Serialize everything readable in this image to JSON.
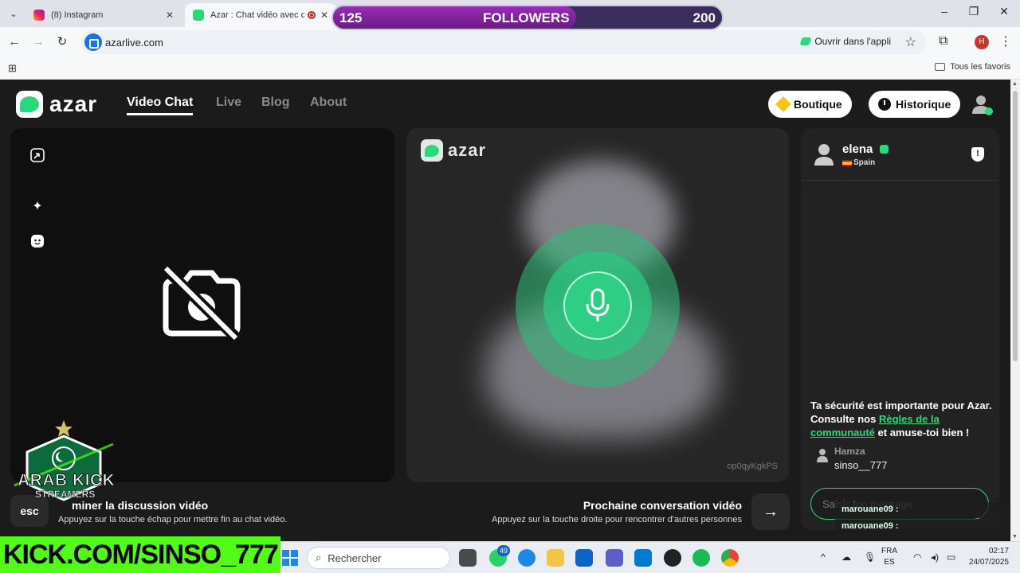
{
  "browser": {
    "tabs": [
      {
        "title": "(8) Instagram",
        "favicon": "instagram-icon"
      },
      {
        "title": "Azar : Chat vidéo avec de n",
        "favicon": "azar-icon"
      }
    ],
    "url": "azarlive.com",
    "open_in_app": "Ouvrir dans l'appli",
    "profile_initial": "H",
    "all_bookmarks": "Tous les favoris"
  },
  "overlay": {
    "followers_current": "125",
    "followers_label": "FOLLOWERS",
    "followers_goal": "200",
    "followers_progress": 0.625,
    "badge_line1": "ARAB KICK",
    "badge_line2": "STREAMERS",
    "kick_url": "KICK.COM/SINSO_777",
    "chat_lines": [
      {
        "user": "marouane09 :"
      },
      {
        "user": "marouane09 :"
      }
    ]
  },
  "nav": {
    "brand": "azar",
    "links": [
      "Video Chat",
      "Live",
      "Blog",
      "About"
    ],
    "boutique": "Boutique",
    "historique": "Historique"
  },
  "video": {
    "brand": "azar",
    "peer_id": "op0qyKgkPS",
    "end_title": "Terminer la discussion vidéo",
    "end_title_visible": "miner la discussion vidéo",
    "end_sub": "Appuyez sur la touche échap pour mettre fin au chat vidéo.",
    "esc": "esc",
    "next_title": "Prochaine conversation vidéo",
    "next_sub": "Appuyez sur la touche droite pour rencontrer d'autres personnes"
  },
  "chat": {
    "peer_name": "elena",
    "peer_country": "Spain",
    "safety_prefix": "Ta sécurité est importante pour Azar. Consulte nos ",
    "safety_link": "Règles de la communauté",
    "safety_suffix": " et amuse-toi bien !",
    "messages": [
      {
        "author": "Hamza",
        "text": "sinso__777"
      }
    ],
    "input_placeholder": "Saisis ton message"
  },
  "taskbar": {
    "search": "Rechercher",
    "whatsapp_badge": "49",
    "lang_top": "FRA",
    "lang_bottom": "ES",
    "time": "02:17",
    "date": "24/07/2025"
  },
  "colors": {
    "accent": "#2bd97c",
    "kick_green": "#53fc18",
    "followers_bar": "#8e24aa"
  }
}
